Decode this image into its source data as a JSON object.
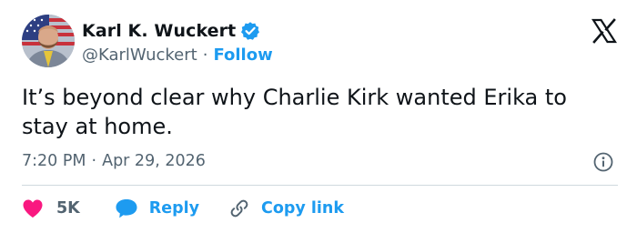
{
  "user": {
    "display_name": "Karl K. Wuckert",
    "handle": "@KarlWuckert",
    "separator": "·",
    "follow_label": "Follow"
  },
  "tweet": {
    "text": "It’s beyond clear why Charlie Kirk wanted Erika to stay at home.",
    "time": "7:20 PM",
    "date": "Apr 29, 2026",
    "separator": "·"
  },
  "actions": {
    "like_count": "5K",
    "reply_label": "Reply",
    "copy_label": "Copy link"
  },
  "icons": {
    "verified": "verified-badge-icon",
    "brand": "x-logo-icon",
    "info": "info-icon",
    "like": "heart-icon",
    "reply": "speech-bubble-icon",
    "copy": "link-icon"
  },
  "colors": {
    "text": "#0f1419",
    "secondary": "#536471",
    "accent": "#1d9bf0",
    "like": "#f91880",
    "divider": "#cfd9de"
  }
}
